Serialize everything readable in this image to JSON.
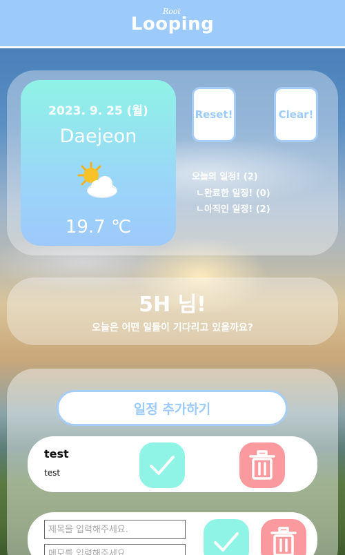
{
  "header": {
    "logo_small": "Root",
    "logo": "Looping"
  },
  "weather": {
    "date": "2023. 9. 25 (월)",
    "city": "Daejeon",
    "icon": "sun-behind-cloud-icon",
    "temperature": "19.7 ℃"
  },
  "buttons": {
    "reset": "Reset!",
    "clear": "Clear!"
  },
  "stats": {
    "today": "오늘의 일정! (2)",
    "done": "ㄴ완료한 일정! (0)",
    "pending": "ㄴ아직인 일정! (2)"
  },
  "greeting": {
    "name": "5H 님!",
    "subtitle": "오늘은 어떤 일들이 기다리고 있을까요?"
  },
  "todo": {
    "add_label": "일정 추가하기",
    "items": [
      {
        "title": "test",
        "memo": "test"
      }
    ],
    "new_item": {
      "title_placeholder": "제목을 입력해주세요.",
      "memo_placeholder": "메모를 입력해주세요."
    }
  },
  "colors": {
    "accent": "#9ccbfb",
    "done": "#8ff3e6",
    "delete": "#fa9a9e"
  }
}
